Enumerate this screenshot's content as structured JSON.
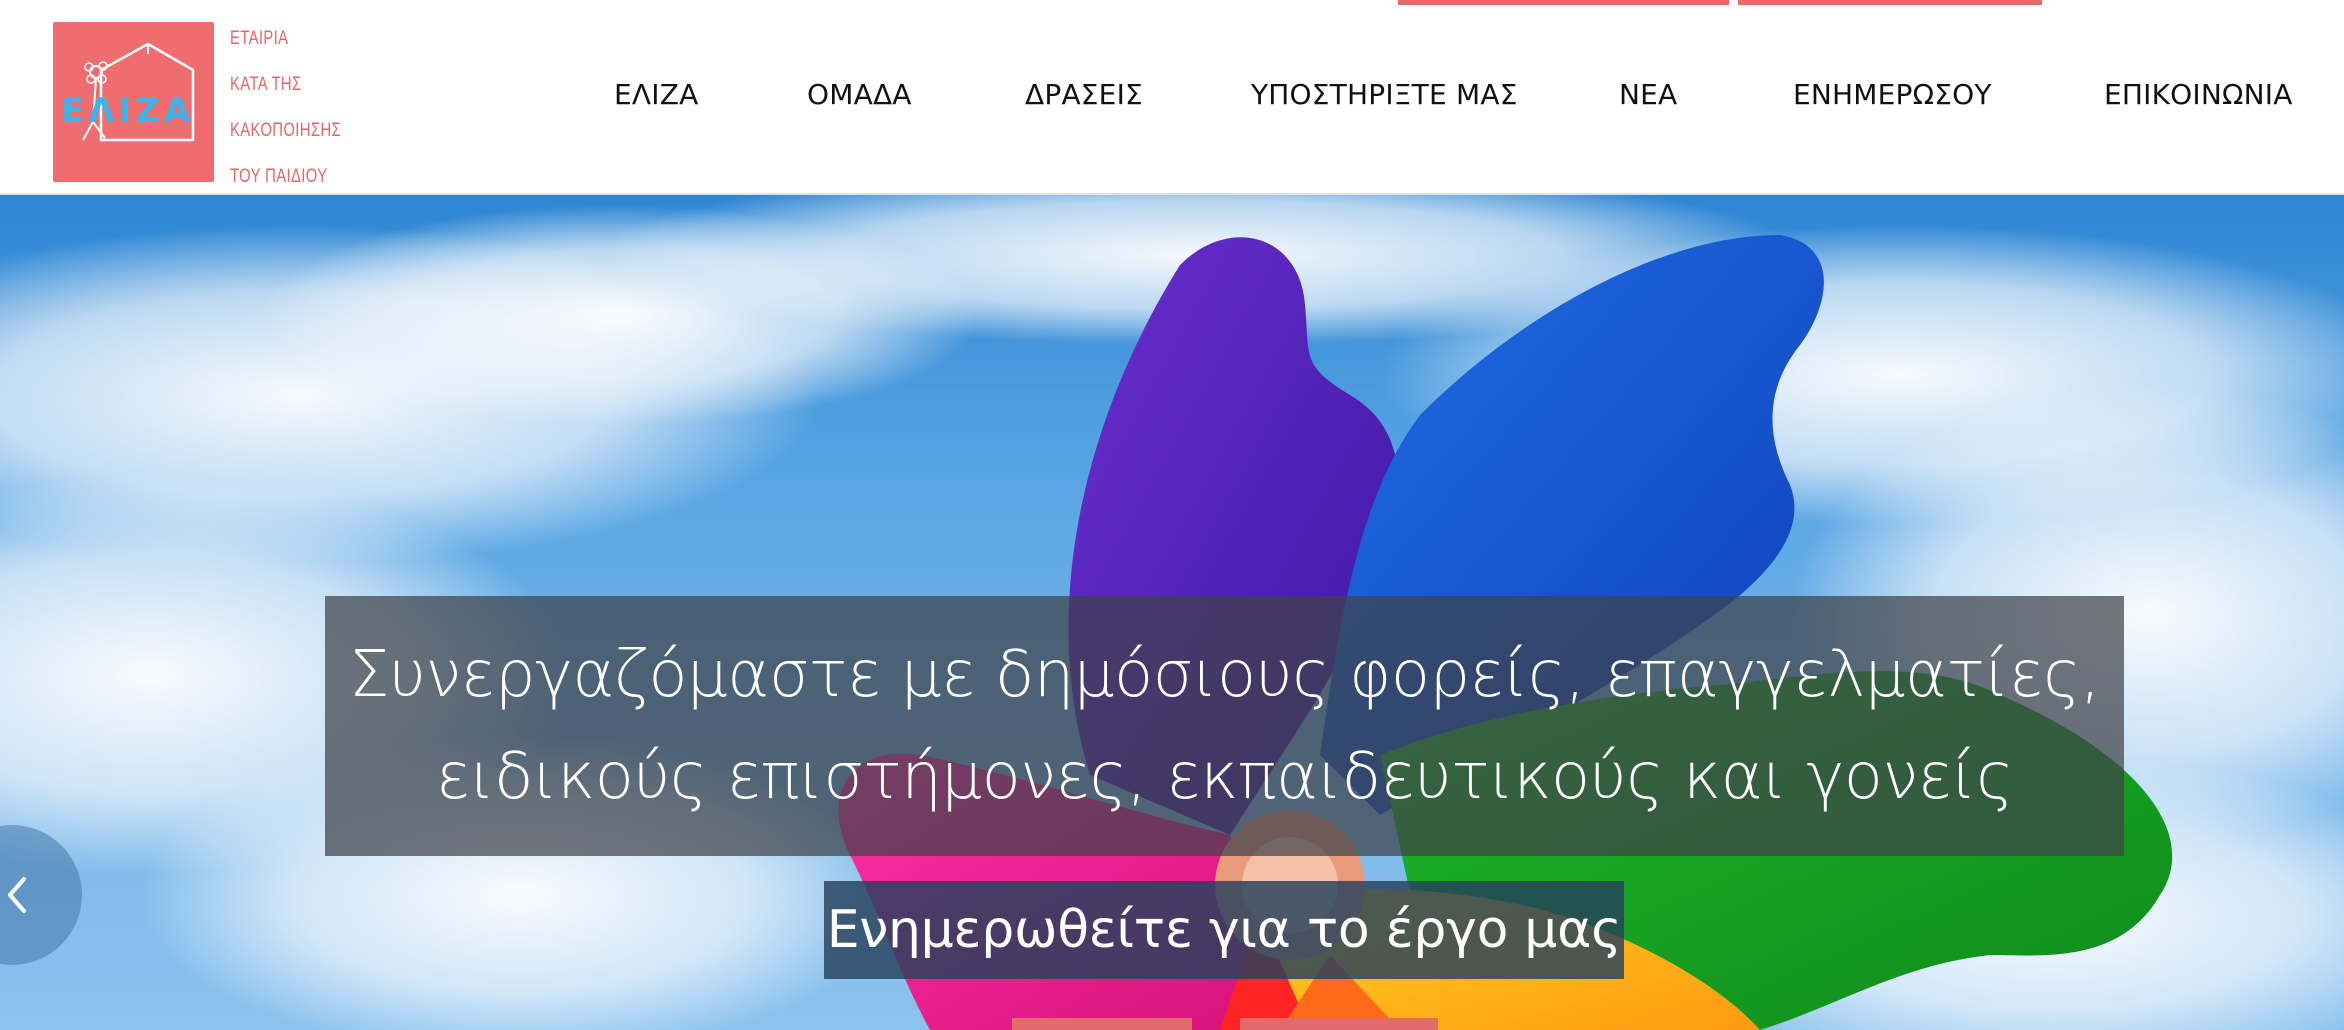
{
  "logo": {
    "letters": "ΕΛΙΖΑ",
    "lines": [
      "ΕΤΑΙΡΙΑ",
      "ΚΑΤΑ ΤΗΣ",
      "ΚΑΚΟΠΟΙΗΣΗΣ",
      "ΤΟΥ ΠΑΙΔΙΟΥ"
    ]
  },
  "nav": {
    "items": [
      "ΕΛΙΖΑ",
      "ΟΜΑΔΑ",
      "ΔΡΑΣΕΙΣ",
      "ΥΠΟΣΤΗΡΙΞΤΕ ΜΑΣ",
      "ΝΕΑ",
      "ΕΝΗΜΕΡΩΣΟΥ",
      "ΕΠΙΚΟΙΝΩΝΙΑ"
    ]
  },
  "hero": {
    "caption_line1": "Συνεργαζόμαστε με δημόσιους φορείς, επαγγελματίες,",
    "caption_line2": "ειδικούς επιστήμονες, εκπαιδευτικούς και γονείς",
    "cta_label": "Ενημερωθείτε για το έργο μας",
    "prev_icon": "chevron-left-icon"
  },
  "colors": {
    "brand": "#ef6d6f",
    "brand_text": "#e66567",
    "nav_text": "#111111",
    "caption_bg": "#3e434a",
    "cta_bg": "#26415c"
  }
}
